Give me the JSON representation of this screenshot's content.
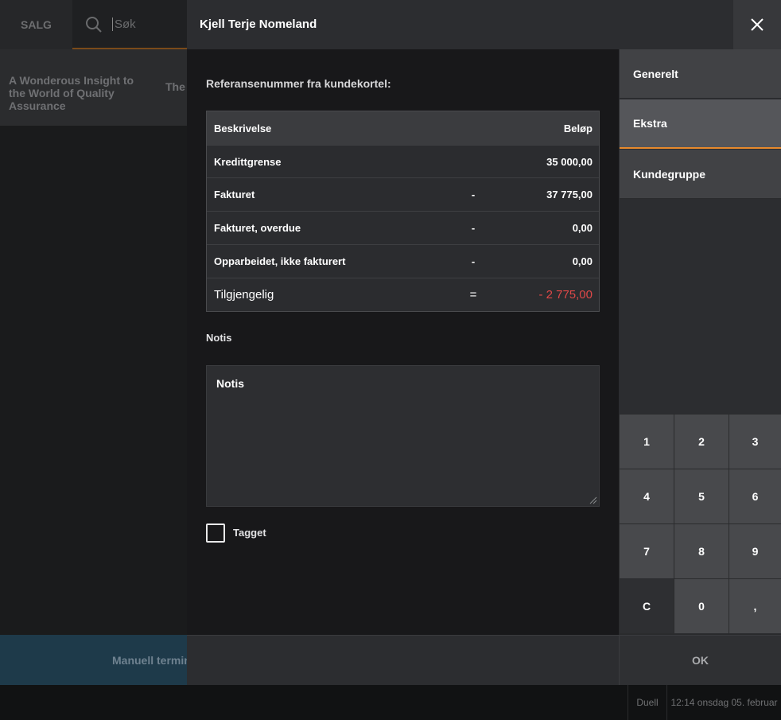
{
  "background": {
    "salg_tab": "SALG",
    "search_placeholder": "Søk",
    "product_1": "A Wonderous Insight to the World of Quality Assurance",
    "product_2": "The",
    "manual_terminal": "Manuell termin",
    "status_user": "Duell",
    "status_datetime": "12:14 onsdag 05. februar"
  },
  "dialog": {
    "title": "Kjell Terje Nomeland",
    "reference_label": "Referansenummer fra kundekortel:",
    "table": {
      "headers": [
        "Beskrivelse",
        "Beløp"
      ],
      "rows": [
        {
          "label": "Kredittgrense",
          "op": "",
          "amount": "35 000,00"
        },
        {
          "label": "Fakturet",
          "op": "-",
          "amount": "37 775,00"
        },
        {
          "label": "Fakturet, overdue",
          "op": "-",
          "amount": "0,00"
        },
        {
          "label": "Opparbeidet, ikke fakturert",
          "op": "-",
          "amount": "0,00"
        },
        {
          "label": "Tilgjengelig",
          "op": "=",
          "amount": "- 2 775,00"
        }
      ]
    },
    "notes_label": "Notis",
    "notes_value": "Notis",
    "tagged_label": "Tagget",
    "tagged_checked": false
  },
  "side_tabs": [
    "Generelt",
    "Ekstra",
    "Kundegruppe"
  ],
  "active_tab": "Ekstra",
  "numpad": [
    "1",
    "2",
    "3",
    "4",
    "5",
    "6",
    "7",
    "8",
    "9",
    "C",
    "0",
    ","
  ],
  "ok_label": "OK",
  "colors": {
    "accent": "#e88a2c",
    "negative": "#e04848"
  }
}
